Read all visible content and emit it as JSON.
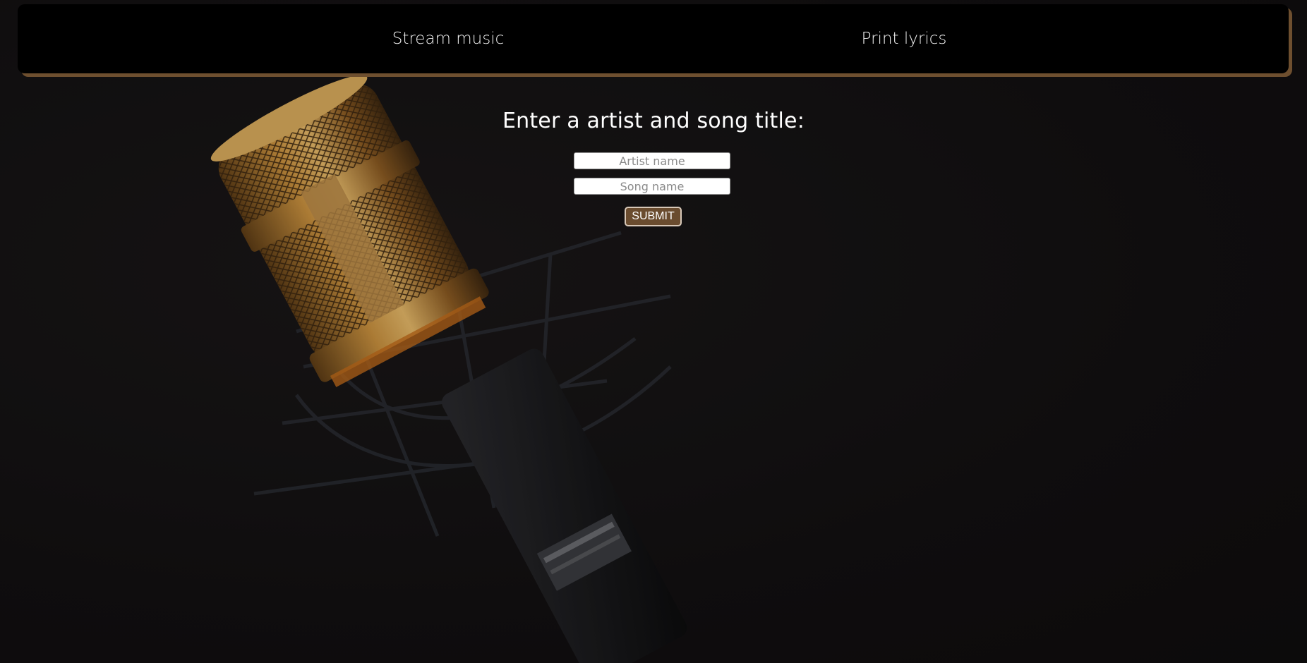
{
  "nav": {
    "links": [
      {
        "label": "Stream music"
      },
      {
        "label": "Print lyrics"
      }
    ]
  },
  "form": {
    "title": "Enter a artist and song title:",
    "artist_placeholder": "Artist name",
    "song_placeholder": "Song name",
    "submit_label": "SUBMIT"
  },
  "colors": {
    "accent": "#6e4f2f",
    "navbar_bg": "#000000",
    "page_bg": "#141213",
    "button_bg": "#6a4c2f"
  },
  "background": {
    "image": "microphone-photo"
  }
}
